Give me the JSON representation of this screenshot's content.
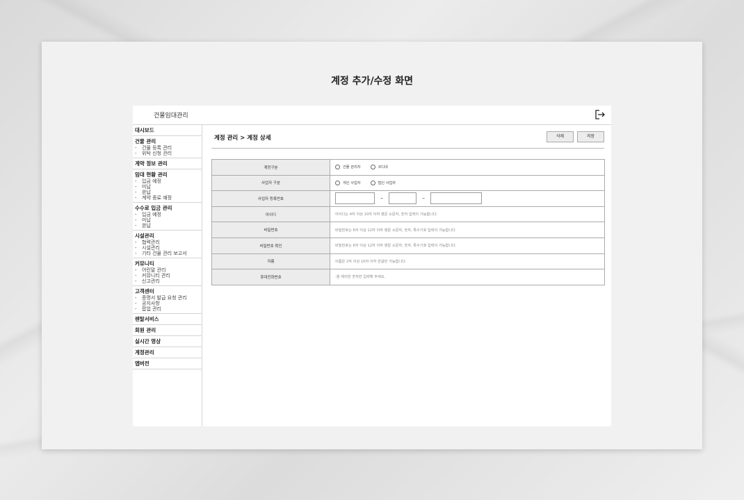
{
  "page_title": "계정 추가/수정 화면",
  "app": {
    "title": "건물임대관리",
    "logout_icon": "logout-icon"
  },
  "sidebar": {
    "groups": [
      {
        "head": "대시보드",
        "subs": []
      },
      {
        "head": "건물 관리",
        "subs": [
          "건물 등록 관리",
          "위탁 신청 관리"
        ]
      },
      {
        "head": "계약 정보 관리",
        "subs": []
      },
      {
        "head": "임대 현황 관리",
        "subs": [
          "입금 예정",
          "미납",
          "완납",
          "계약 종료 예정"
        ]
      },
      {
        "head": "수수료 입금 관리",
        "subs": [
          "입금 예정",
          "미납",
          "완납"
        ]
      },
      {
        "head": "시설관리",
        "subs": [
          "협력관리",
          "시설관리",
          "기타 건물 관리 보고서"
        ]
      },
      {
        "head": "커뮤니티",
        "subs": [
          "어린말 관리",
          "커뮤니티 관리",
          "신고관리"
        ]
      },
      {
        "head": "고객센터",
        "subs": [
          "증명서 발급 요청 관리",
          "공지사항",
          "팝업 관리"
        ]
      },
      {
        "head": "렌탈서비스",
        "subs": []
      },
      {
        "head": "회원 관리",
        "subs": []
      },
      {
        "head": "실시간 영상",
        "subs": []
      },
      {
        "head": "계정관리",
        "subs": []
      },
      {
        "head": "앱버전",
        "subs": []
      }
    ]
  },
  "main": {
    "breadcrumb": "계정 관리 > 계정 상세",
    "delete_label": "삭제",
    "save_label": "저장"
  },
  "form": {
    "account_type": {
      "label": "계정구분",
      "options": [
        "건물 관리자",
        "코디네"
      ]
    },
    "business_type": {
      "label": "사업자 구분",
      "options": [
        "개인 사업자",
        "법인 사업자"
      ]
    },
    "business_number": {
      "label": "사업자 등록번호",
      "separator": "–"
    },
    "user_id": {
      "label": "아이디",
      "placeholder": "아이디는 4자 이상 10자 이하 영문 소문자, 숫자 입력이 가능합니다."
    },
    "password": {
      "label": "비밀번호",
      "placeholder": "비밀번호는 6자 이상 12자 이하 영문 소문자, 숫자, 특수기호 입력이 가능합니다."
    },
    "password_confirm": {
      "label": "비밀번호 확인",
      "placeholder": "비밀번호는 6자 이상 12자 이하 영문 소문자, 숫자, 특수기호 입력이 가능합니다."
    },
    "name": {
      "label": "이름",
      "placeholder": "이름은 2자 이상 10자 이하 한글만 가능합니다."
    },
    "phone": {
      "label": "휴대전화번호",
      "placeholder": "-을 제외한 숫자만 입력해 주세요."
    }
  }
}
